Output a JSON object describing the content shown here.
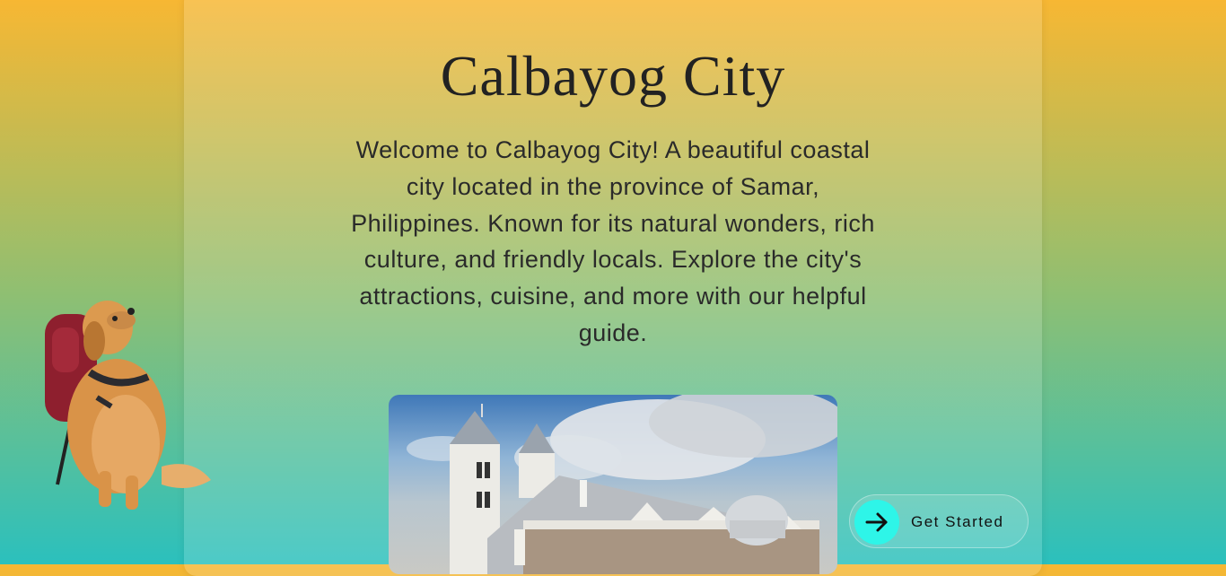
{
  "hero": {
    "title": "Calbayog City",
    "description": "Welcome to Calbayog City! A beautiful coastal city located in the province of Samar, Philippines. Known for its natural wonders, rich culture, and friendly locals. Explore the city's attractions, cuisine, and more with our helpful guide."
  },
  "cta": {
    "label": "Get Started",
    "icon": "arrow-right-icon",
    "accent": "#2ef5e8"
  },
  "images": {
    "mascot": "golden-retriever-with-backpack",
    "photo": "church-with-bell-towers"
  },
  "colors": {
    "background_top": "#f7b733",
    "background_middle": "#8fbf72",
    "background_bottom": "#2bc0bd"
  }
}
